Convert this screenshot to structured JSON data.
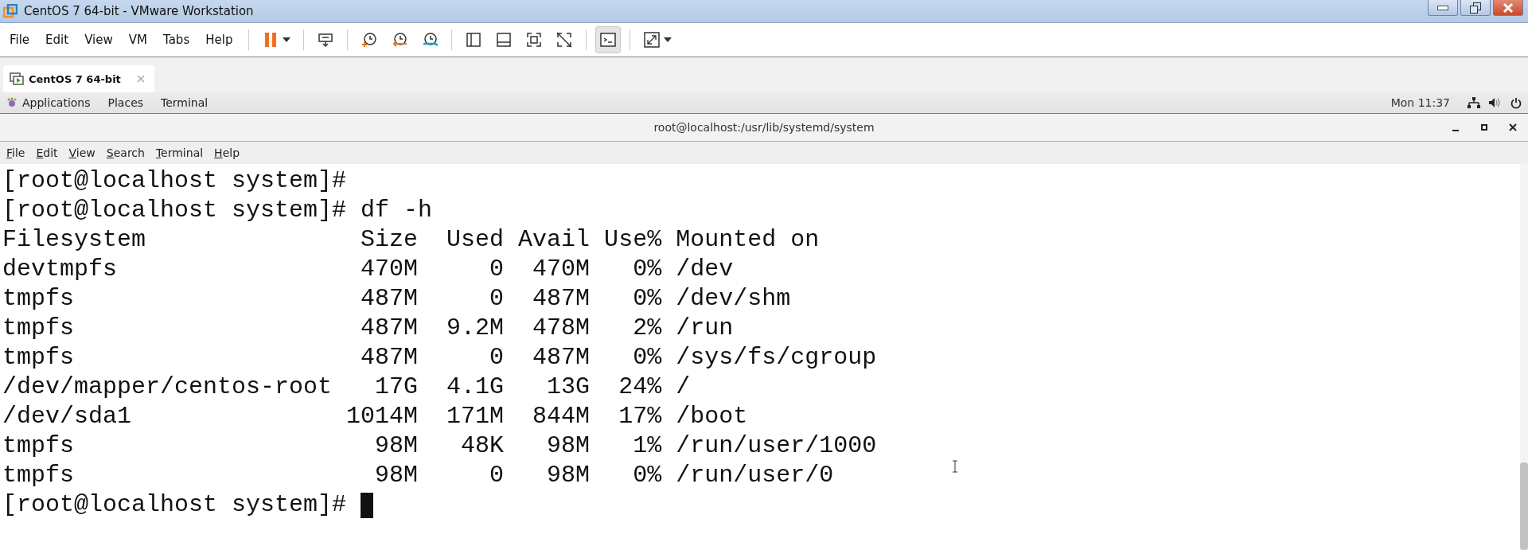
{
  "window": {
    "title": "CentOS 7 64-bit - VMware Workstation"
  },
  "menu": [
    "File",
    "Edit",
    "View",
    "VM",
    "Tabs",
    "Help"
  ],
  "toolbar": [
    {
      "kind": "pause",
      "selected": false
    },
    {
      "kind": "send-keys",
      "selected": false
    },
    {
      "kind": "snapshot",
      "selected": false
    },
    {
      "kind": "revert",
      "selected": false
    },
    {
      "kind": "manage",
      "selected": false
    },
    {
      "kind": "sidebar",
      "selected": false
    },
    {
      "kind": "thumbs",
      "selected": false
    },
    {
      "kind": "fit",
      "selected": false
    },
    {
      "kind": "nofit",
      "selected": false
    },
    {
      "kind": "console",
      "selected": true
    },
    {
      "kind": "fullscreen",
      "selected": false
    }
  ],
  "tabs": [
    {
      "label": "CentOS 7 64-bit",
      "selected": true
    }
  ],
  "guest_bar": {
    "menus": [
      "Applications",
      "Places",
      "Terminal"
    ],
    "clock": "Mon 11:37"
  },
  "terminal": {
    "title": "root@localhost:/usr/lib/systemd/system",
    "menu": [
      {
        "label": "File",
        "mnemonic": true
      },
      {
        "label": "Edit",
        "mnemonic": true
      },
      {
        "label": "View",
        "mnemonic": true
      },
      {
        "label": "Search",
        "mnemonic": true
      },
      {
        "label": "Terminal",
        "mnemonic": true
      },
      {
        "label": "Help",
        "mnemonic": true
      }
    ],
    "lines": [
      "[root@localhost system]#",
      "[root@localhost system]# df -h",
      "Filesystem               Size  Used Avail Use% Mounted on",
      "devtmpfs                 470M     0  470M   0% /dev",
      "tmpfs                    487M     0  487M   0% /dev/shm",
      "tmpfs                    487M  9.2M  478M   2% /run",
      "tmpfs                    487M     0  487M   0% /sys/fs/cgroup",
      "/dev/mapper/centos-root   17G  4.1G   13G  24% /",
      "/dev/sda1               1014M  171M  844M  17% /boot",
      "tmpfs                     98M   48K   98M   1% /run/user/1000",
      "tmpfs                     98M     0   98M   0% /run/user/0",
      "[root@localhost system]# "
    ],
    "cursor": true
  }
}
